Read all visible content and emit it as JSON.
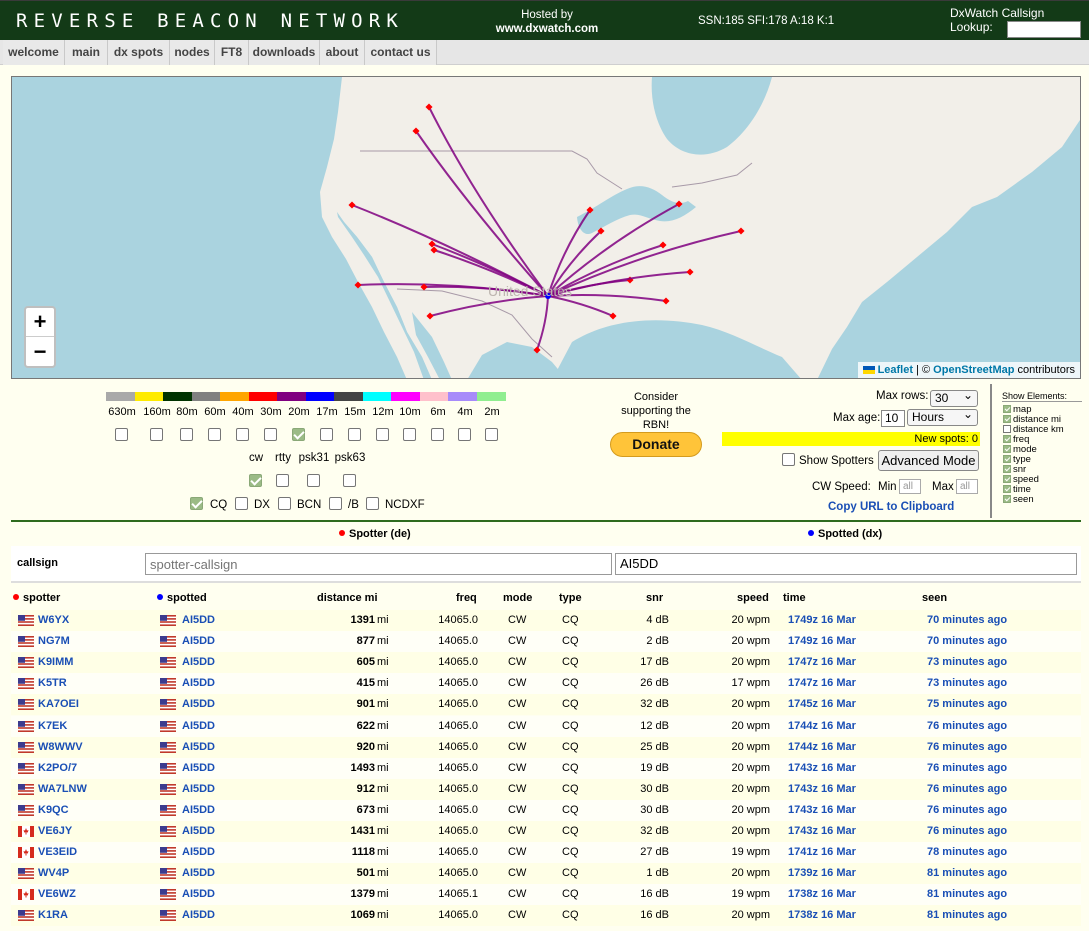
{
  "header": {
    "site_title": "REVERSE BEACON NETWORK",
    "hosted_by": "Hosted by",
    "host": "www.dxwatch.com",
    "solar": "SSN:185 SFI:178 A:18 K:1",
    "lookup_label": "DxWatch Callsign Lookup:",
    "lookup_value": ""
  },
  "nav": [
    "welcome",
    "main",
    "dx spots",
    "nodes",
    "FT8",
    "downloads",
    "about",
    "contact us"
  ],
  "map": {
    "zoom_in": "+",
    "zoom_out": "−",
    "map_label": "United States",
    "attribution": {
      "leaflet": "Leaflet",
      "sep": " | © ",
      "osm": "OpenStreetMap",
      "suffix": " contributors"
    },
    "line_color": "#800080",
    "spotter_color": "#ff0000",
    "spotted_color": "#0000ff"
  },
  "bands": [
    {
      "label": "630m",
      "color": "#a9a9a9",
      "checked": false
    },
    {
      "label": "160m",
      "color": "#ffeb00",
      "checked": false
    },
    {
      "label": "80m",
      "color": "#003300",
      "checked": false
    },
    {
      "label": "60m",
      "color": "#808080",
      "checked": false
    },
    {
      "label": "40m",
      "color": "#ffa500",
      "checked": false
    },
    {
      "label": "30m",
      "color": "#ff0000",
      "checked": false
    },
    {
      "label": "20m",
      "color": "#800080",
      "checked": true
    },
    {
      "label": "17m",
      "color": "#0000ff",
      "checked": false
    },
    {
      "label": "15m",
      "color": "#444444",
      "checked": false
    },
    {
      "label": "12m",
      "color": "#00ffff",
      "checked": false
    },
    {
      "label": "10m",
      "color": "#ff00ff",
      "checked": false
    },
    {
      "label": "6m",
      "color": "#ffc0cb",
      "checked": false
    },
    {
      "label": "4m",
      "color": "#a78bfa",
      "checked": false
    },
    {
      "label": "2m",
      "color": "#90ee90",
      "checked": false
    }
  ],
  "modes": [
    {
      "label": "cw",
      "checked": true
    },
    {
      "label": "rtty",
      "checked": false
    },
    {
      "label": "psk31",
      "checked": false
    },
    {
      "label": "psk63",
      "checked": false
    }
  ],
  "types": [
    {
      "label": "CQ",
      "checked": true
    },
    {
      "label": "DX",
      "checked": false
    },
    {
      "label": "BCN",
      "checked": false
    },
    {
      "label": "/B",
      "checked": false
    },
    {
      "label": "NCDXF",
      "checked": false
    }
  ],
  "donate": {
    "text": "Consider supporting the RBN!",
    "button": "Donate"
  },
  "options": {
    "max_rows_label": "Max rows:",
    "max_rows": "30",
    "max_age_label": "Max age:",
    "max_age": "10",
    "max_age_unit": "Hours",
    "new_spots": "New spots: 0",
    "show_spotters": "Show Spotters",
    "advanced": "Advanced Mode",
    "cw_speed": "CW Speed:",
    "min": "Min",
    "max": "Max",
    "all": "all",
    "copy_url": "Copy URL to Clipboard"
  },
  "elements": {
    "title": "Show Elements:",
    "items": [
      {
        "label": "map",
        "checked": true
      },
      {
        "label": "distance mi",
        "checked": true
      },
      {
        "label": "distance km",
        "checked": false
      },
      {
        "label": "freq",
        "checked": true
      },
      {
        "label": "mode",
        "checked": true
      },
      {
        "label": "type",
        "checked": true
      },
      {
        "label": "snr",
        "checked": true
      },
      {
        "label": "speed",
        "checked": true
      },
      {
        "label": "time",
        "checked": true
      },
      {
        "label": "seen",
        "checked": true
      }
    ]
  },
  "filter": {
    "spotter_legend": "Spotter (de)",
    "spotted_legend": "Spotted (dx)",
    "callsign_label": "callsign",
    "spotter_placeholder": "spotter-callsign",
    "spotted_value": "AI5DD"
  },
  "columns": {
    "spotter": "spotter",
    "spotted": "spotted",
    "distance": "distance mi",
    "freq": "freq",
    "mode": "mode",
    "type": "type",
    "snr": "snr",
    "speed": "speed",
    "time": "time",
    "seen": "seen"
  },
  "unit_mi": "mi",
  "rows": [
    {
      "spotter": "W6YX",
      "flag": "us",
      "spotted": "AI5DD",
      "distance": "1391",
      "freq": "14065.0",
      "mode": "CW",
      "type": "CQ",
      "snr": "4 dB",
      "speed": "20 wpm",
      "time": "1749z 16 Mar",
      "seen": "70 minutes ago"
    },
    {
      "spotter": "NG7M",
      "flag": "us",
      "spotted": "AI5DD",
      "distance": "877",
      "freq": "14065.0",
      "mode": "CW",
      "type": "CQ",
      "snr": "2 dB",
      "speed": "20 wpm",
      "time": "1749z 16 Mar",
      "seen": "70 minutes ago"
    },
    {
      "spotter": "K9IMM",
      "flag": "us",
      "spotted": "AI5DD",
      "distance": "605",
      "freq": "14065.0",
      "mode": "CW",
      "type": "CQ",
      "snr": "17 dB",
      "speed": "20 wpm",
      "time": "1747z 16 Mar",
      "seen": "73 minutes ago"
    },
    {
      "spotter": "K5TR",
      "flag": "us",
      "spotted": "AI5DD",
      "distance": "415",
      "freq": "14065.0",
      "mode": "CW",
      "type": "CQ",
      "snr": "26 dB",
      "speed": "17 wpm",
      "time": "1747z 16 Mar",
      "seen": "73 minutes ago"
    },
    {
      "spotter": "KA7OEI",
      "flag": "us",
      "spotted": "AI5DD",
      "distance": "901",
      "freq": "14065.0",
      "mode": "CW",
      "type": "CQ",
      "snr": "32 dB",
      "speed": "20 wpm",
      "time": "1745z 16 Mar",
      "seen": "75 minutes ago"
    },
    {
      "spotter": "K7EK",
      "flag": "us",
      "spotted": "AI5DD",
      "distance": "622",
      "freq": "14065.0",
      "mode": "CW",
      "type": "CQ",
      "snr": "12 dB",
      "speed": "20 wpm",
      "time": "1744z 16 Mar",
      "seen": "76 minutes ago"
    },
    {
      "spotter": "W8WWV",
      "flag": "us",
      "spotted": "AI5DD",
      "distance": "920",
      "freq": "14065.0",
      "mode": "CW",
      "type": "CQ",
      "snr": "25 dB",
      "speed": "20 wpm",
      "time": "1744z 16 Mar",
      "seen": "76 minutes ago"
    },
    {
      "spotter": "K2PO/7",
      "flag": "us",
      "spotted": "AI5DD",
      "distance": "1493",
      "freq": "14065.0",
      "mode": "CW",
      "type": "CQ",
      "snr": "19 dB",
      "speed": "20 wpm",
      "time": "1743z 16 Mar",
      "seen": "76 minutes ago"
    },
    {
      "spotter": "WA7LNW",
      "flag": "us",
      "spotted": "AI5DD",
      "distance": "912",
      "freq": "14065.0",
      "mode": "CW",
      "type": "CQ",
      "snr": "30 dB",
      "speed": "20 wpm",
      "time": "1743z 16 Mar",
      "seen": "76 minutes ago"
    },
    {
      "spotter": "K9QC",
      "flag": "us",
      "spotted": "AI5DD",
      "distance": "673",
      "freq": "14065.0",
      "mode": "CW",
      "type": "CQ",
      "snr": "30 dB",
      "speed": "20 wpm",
      "time": "1743z 16 Mar",
      "seen": "76 minutes ago"
    },
    {
      "spotter": "VE6JY",
      "flag": "ca",
      "spotted": "AI5DD",
      "distance": "1431",
      "freq": "14065.0",
      "mode": "CW",
      "type": "CQ",
      "snr": "32 dB",
      "speed": "20 wpm",
      "time": "1743z 16 Mar",
      "seen": "76 minutes ago"
    },
    {
      "spotter": "VE3EID",
      "flag": "ca",
      "spotted": "AI5DD",
      "distance": "1118",
      "freq": "14065.0",
      "mode": "CW",
      "type": "CQ",
      "snr": "27 dB",
      "speed": "19 wpm",
      "time": "1741z 16 Mar",
      "seen": "78 minutes ago"
    },
    {
      "spotter": "WV4P",
      "flag": "us",
      "spotted": "AI5DD",
      "distance": "501",
      "freq": "14065.0",
      "mode": "CW",
      "type": "CQ",
      "snr": "1 dB",
      "speed": "20 wpm",
      "time": "1739z 16 Mar",
      "seen": "81 minutes ago"
    },
    {
      "spotter": "VE6WZ",
      "flag": "ca",
      "spotted": "AI5DD",
      "distance": "1379",
      "freq": "14065.1",
      "mode": "CW",
      "type": "CQ",
      "snr": "16 dB",
      "speed": "19 wpm",
      "time": "1738z 16 Mar",
      "seen": "81 minutes ago"
    },
    {
      "spotter": "K1RA",
      "flag": "us",
      "spotted": "AI5DD",
      "distance": "1069",
      "freq": "14065.0",
      "mode": "CW",
      "type": "CQ",
      "snr": "16 dB",
      "speed": "20 wpm",
      "time": "1738z 16 Mar",
      "seen": "81 minutes ago"
    }
  ]
}
